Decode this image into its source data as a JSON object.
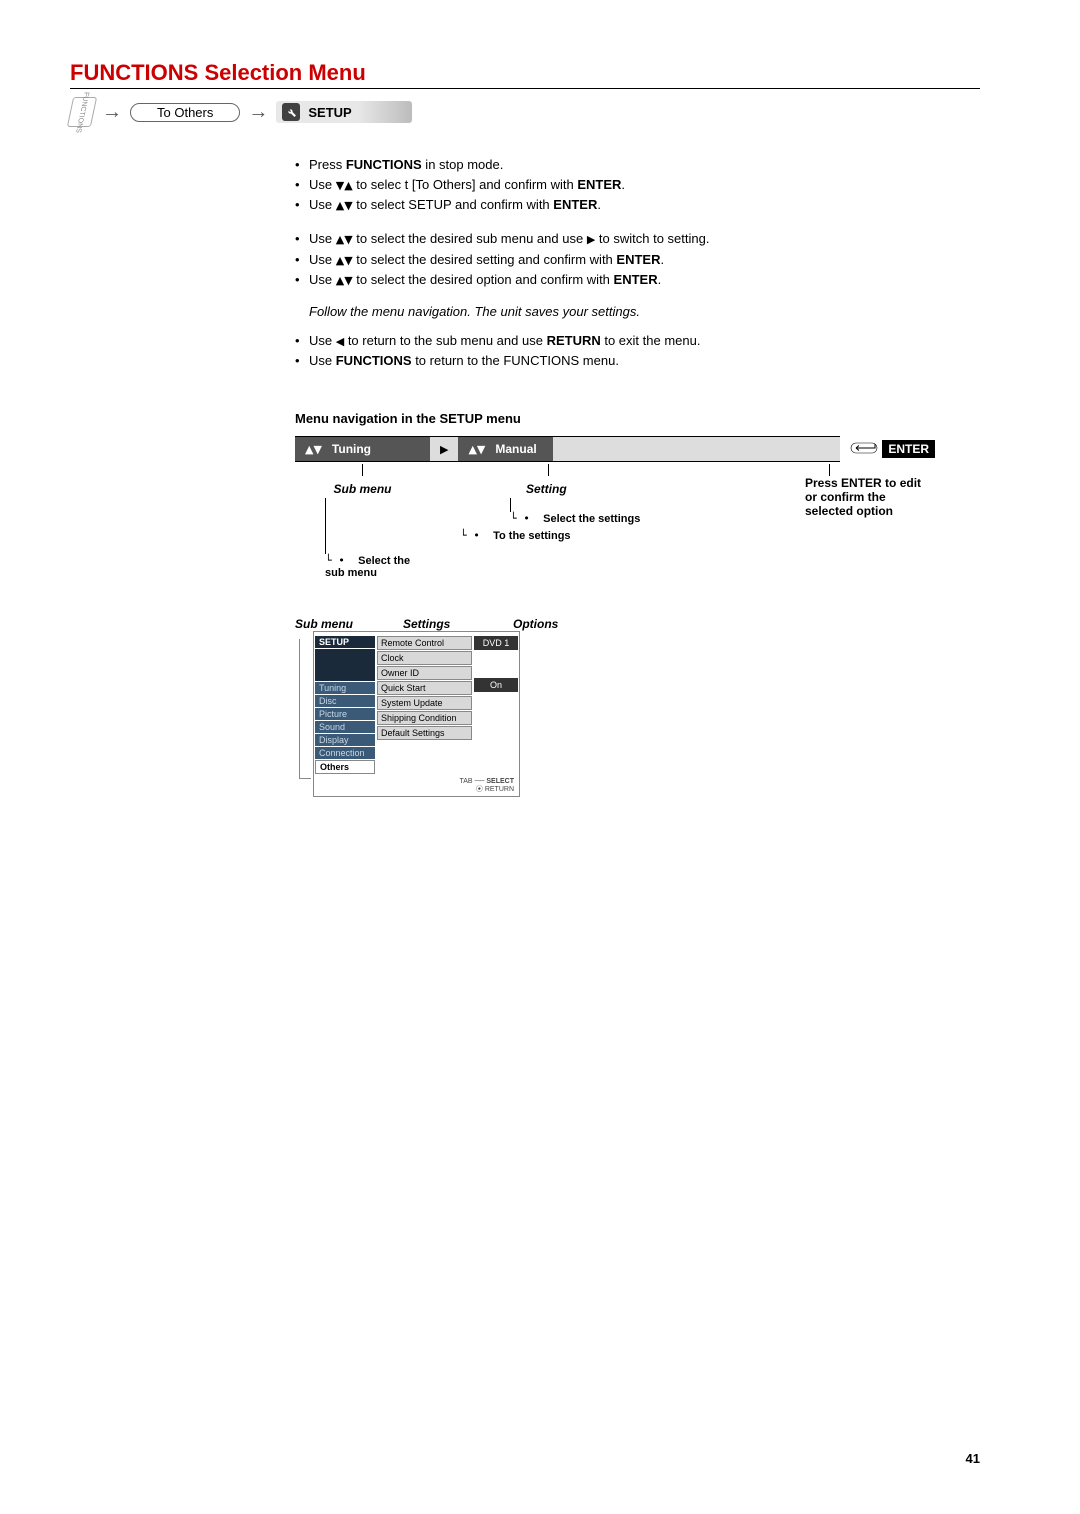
{
  "page_number": "41",
  "title": "FUNCTIONS Selection Menu",
  "breadcrumb": {
    "icon_label": "FUNCTIONS",
    "pill": "To Others",
    "setup": "SETUP"
  },
  "instructions_block1": [
    {
      "pre": "Press ",
      "bold1": "FUNCTIONS",
      "post": " in stop mode."
    },
    {
      "pre": "Use ",
      "tri": "▼▲",
      "mid": " to selec  t [To Others] and confirm with ",
      "bold1": "ENTER",
      "post": "."
    },
    {
      "pre": "Use ",
      "tri": "▲▼",
      "mid": " to select SETUP and confirm with ",
      "bold1": "ENTER",
      "post": "."
    }
  ],
  "instructions_block2": [
    {
      "pre": "Use ",
      "tri": "▲▼",
      "mid": " to select the desired sub menu and use ",
      "tri2": "▶",
      "post": " to switch to setting."
    },
    {
      "pre": "Use ",
      "tri": "▲▼",
      "mid": " to select the desired setting and confirm with ",
      "bold1": "ENTER",
      "post": "."
    },
    {
      "pre": "Use ",
      "tri": "▲▼",
      "mid": " to select the desired option and confirm with ",
      "bold1": "ENTER",
      "post": "."
    }
  ],
  "followup_note": "Follow the menu navigation. The unit saves your settings.",
  "instructions_block3": [
    {
      "pre": "Use ",
      "tri": "◀",
      "mid": " to return to the sub menu and use ",
      "bold1": "RETURN",
      "post": " to exit the menu."
    },
    {
      "pre": "Use ",
      "bold1": "FUNCTIONS",
      "post": " to return to the FUNCTIONS menu."
    }
  ],
  "nav_heading": "Menu navigation in the SETUP menu",
  "nav": {
    "col1_head": "Tuning",
    "col1_sub": "Sub menu",
    "col1_note": "Select the sub menu",
    "col2_arrow": "▶",
    "col2_note_inner": "To the settings",
    "col3_head": "Manual",
    "col3_sub": "Setting",
    "col3_note": "Select the settings",
    "enter_badge": "ENTER",
    "enter_note": "Press ENTER to edit or confirm the selected option"
  },
  "setup_labels": {
    "sub": "Sub menu",
    "settings": "Settings",
    "options": "Options"
  },
  "setup_mock": {
    "side_active": "SETUP",
    "side_items": [
      "Tuning",
      "Disc",
      "Picture",
      "Sound",
      "Display",
      "Connection"
    ],
    "side_last": "Others",
    "settings_rows": [
      "Remote Control",
      "Clock",
      "Owner ID",
      "Quick Start",
      "System Update",
      "Shipping Condition",
      "Default Settings"
    ],
    "option_top": "DVD 1",
    "option_qs": "On",
    "bottom_tab": "TAB",
    "bottom_select": "SELECT",
    "bottom_return": "RETURN"
  }
}
